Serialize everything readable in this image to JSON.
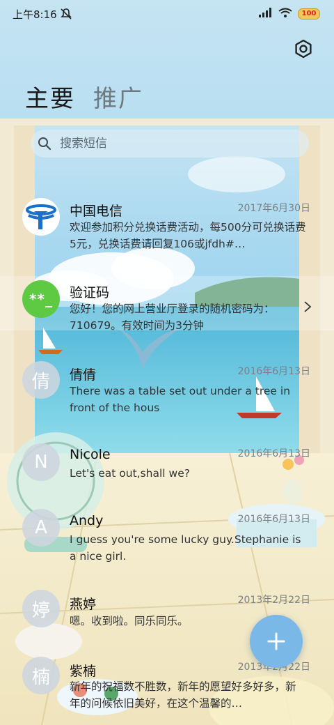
{
  "status_bar": {
    "time": "上午8:16",
    "battery": "100",
    "icons": [
      "mute-icon",
      "signal-icon",
      "wifi-icon",
      "battery-icon"
    ]
  },
  "header": {
    "tabs": [
      {
        "label": "主要",
        "active": true
      },
      {
        "label": "推广",
        "active": false
      }
    ],
    "settings_icon": "gear-icon"
  },
  "search": {
    "placeholder": "搜索短信"
  },
  "conversations": [
    {
      "name": "中国电信",
      "date": "2017年6月30日",
      "preview": "欢迎参加积分兑换话费活动，每500分可兑换话费5元，兑换话费请回复106或jfdh#…",
      "avatar": "logo",
      "avatar_text": ""
    },
    {
      "name": "验证码",
      "date": "",
      "preview": "您好！您的网上营业厅登录的随机密码为：710679。有效时间为3分钟",
      "avatar": "green",
      "avatar_text": "**_"
    },
    {
      "name": "倩倩",
      "date": "2016年6月13日",
      "preview": "There was a table set out under a tree in front of the hous",
      "avatar": "letter",
      "avatar_text": "倩"
    },
    {
      "name": "Nicole",
      "date": "2016年6月13日",
      "preview": "Let's eat out,shall we?",
      "avatar": "letter",
      "avatar_text": "N"
    },
    {
      "name": "Andy",
      "date": "2016年6月13日",
      "preview": "I guess you're some lucky guy.Stephanie is a nice girl.",
      "avatar": "letter",
      "avatar_text": "A"
    },
    {
      "name": "燕婷",
      "date": "2013年2月22日",
      "preview": "嗯。收到啦。同乐同乐。",
      "avatar": "letter",
      "avatar_text": "婷"
    },
    {
      "name": "紫楠",
      "date": "2013年2月22日",
      "preview": "新年的祝福数不胜数，新年的愿望好多好多，新年的问候依旧美好，在这个温馨的…",
      "avatar": "letter",
      "avatar_text": "楠"
    }
  ],
  "fab": {
    "icon": "plus-icon"
  },
  "colors": {
    "fab": "#7ab8e8",
    "code_avatar": "#5ec942",
    "telecom_blue": "#1a6fc9"
  }
}
